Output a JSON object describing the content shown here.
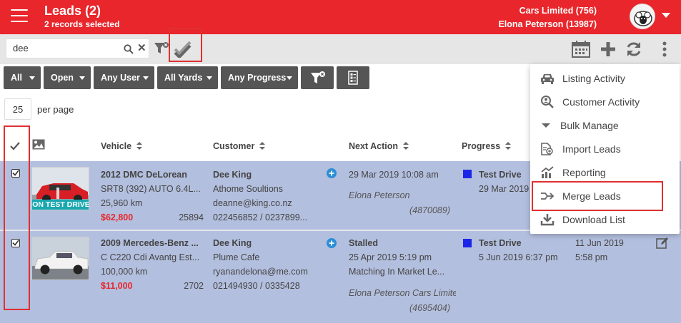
{
  "header": {
    "title": "Leads (2)",
    "subtitle": "2 records selected",
    "company": "Cars Limited (756)",
    "user": "Elona Peterson (13987)"
  },
  "toolbar": {
    "search_value": "dee",
    "icons": [
      "search-icon",
      "clear-icon",
      "filter-clear-icon",
      "bulk-select-icon",
      "calendar-icon",
      "add-icon",
      "refresh-icon",
      "more-vert-icon"
    ]
  },
  "filters": [
    "All",
    "Open",
    "Any User",
    "All Yards",
    "Any Progress"
  ],
  "pagination": {
    "per_page": "25",
    "per_page_label": "per page"
  },
  "table": {
    "headers": {
      "vehicle": "Vehicle",
      "customer": "Customer",
      "next_action": "Next Action",
      "progress": "Progress"
    },
    "rows": [
      {
        "vehicle_title": "2012 DMC DeLorean",
        "vehicle_sub": "SRT8 (392) AUTO 6.4L...",
        "km": "25,960 km",
        "price": "$62,800",
        "stock": "25894",
        "badge": "ON TEST DRIVE",
        "customer_name": "Dee King",
        "company": "Athome Soultions",
        "email": "deanne@king.co.nz",
        "phone": "022456852 / 0237899...",
        "next_action_title": "29 Mar 2019 10:08 am",
        "next_action_line2": "",
        "next_action_line3": "",
        "assignee": "Elona Peterson",
        "lead_id": "(4870089)",
        "progress_title": "Test Drive",
        "progress_date": "29 Mar 2019",
        "extra_date": "",
        "extra_time": ""
      },
      {
        "vehicle_title": "2009 Mercedes-Benz ...",
        "vehicle_sub": "C C220 Cdi Avantg Est...",
        "km": "100,000 km",
        "price": "$11,000",
        "stock": "2702",
        "badge": "",
        "customer_name": "Dee King",
        "company": "Plume Cafe",
        "email": "ryanandelona@me.com",
        "phone": "021494930 / 0335428",
        "next_action_title": "Stalled",
        "next_action_line2": "25 Apr 2019 5:19 pm",
        "next_action_line3": "Matching In Market Le...",
        "assignee": "Elona Peterson Cars Limite",
        "lead_id": "(4695404)",
        "progress_title": "Test Drive",
        "progress_date": "5 Jun 2019 6:37 pm",
        "extra_date": "11 Jun 2019",
        "extra_time": "5:58 pm"
      }
    ]
  },
  "menu": {
    "items": [
      {
        "label": "Listing Activity",
        "icon": "car-icon"
      },
      {
        "label": "Customer Activity",
        "icon": "search-person-icon"
      },
      {
        "label": "Bulk Manage",
        "icon": "caret-down-icon"
      },
      {
        "label": "Import Leads",
        "icon": "import-icon"
      },
      {
        "label": "Reporting",
        "icon": "chart-icon"
      },
      {
        "label": "Merge Leads",
        "icon": "merge-icon"
      },
      {
        "label": "Download List",
        "icon": "download-icon"
      }
    ]
  },
  "colors": {
    "brand_red": "#e8262b",
    "row_selected": "#b3bfde",
    "status_blue": "#1a25e8",
    "badge_teal": "#1aa8b0",
    "highlight": "#e03030"
  }
}
